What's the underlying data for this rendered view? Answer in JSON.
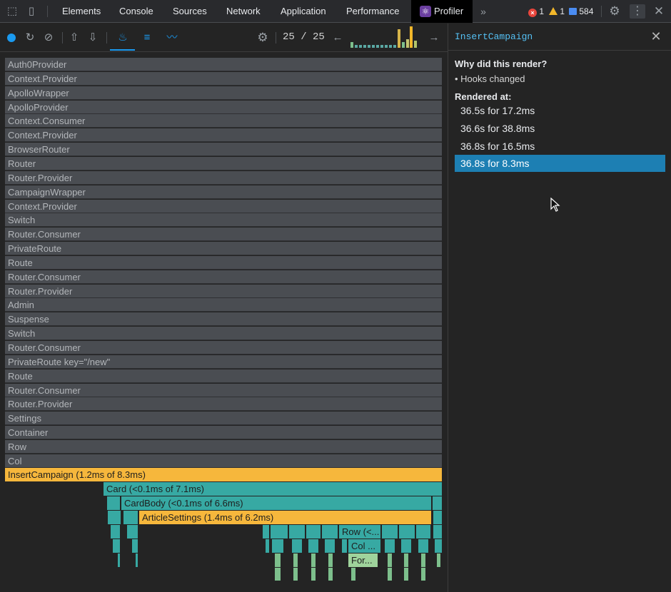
{
  "tabbar": {
    "tabs": [
      "Elements",
      "Console",
      "Sources",
      "Network",
      "Application",
      "Performance",
      "Profiler"
    ],
    "active_tab": "Profiler",
    "more_glyph": "»",
    "errors": "1",
    "warnings": "1",
    "messages": "584"
  },
  "toolbar": {
    "commit_index": "25",
    "commit_sep": "/",
    "commit_total": "25",
    "accent": "#1a9af0"
  },
  "flame": {
    "ancestors": [
      "Auth0Provider",
      "Context.Provider",
      "ApolloWrapper",
      "ApolloProvider",
      "Context.Consumer",
      "Context.Provider",
      "BrowserRouter",
      "Router",
      "Router.Provider",
      "CampaignWrapper",
      "Context.Provider",
      "Switch",
      "Router.Consumer",
      "PrivateRoute",
      "Route",
      "Router.Consumer",
      "Router.Provider",
      "Admin",
      "Suspense",
      "Switch",
      "Router.Consumer",
      "PrivateRoute key=\"/new\"",
      "Route",
      "Router.Consumer",
      "Router.Provider",
      "Settings",
      "Container",
      "Row",
      "Col"
    ],
    "insert_campaign": "InsertCampaign (1.2ms of 8.3ms)",
    "card": "Card (<0.1ms of 7.1ms)",
    "card_body": "CardBody (<0.1ms of 6.6ms)",
    "article_settings": "ArticleSettings (1.4ms of 6.2ms)",
    "row_trunc": "Row (<...",
    "col_trunc": "Col ...",
    "for_trunc": "For..."
  },
  "side": {
    "title": "InsertCampaign",
    "why_label": "Why did this render?",
    "why_reason": "• Hooks changed",
    "rendered_label": "Rendered at:",
    "renders": [
      "36.5s for 17.2ms",
      "36.6s for 38.8ms",
      "36.8s for 16.5ms",
      "36.8s for 8.3ms"
    ],
    "selected_index": 3
  }
}
